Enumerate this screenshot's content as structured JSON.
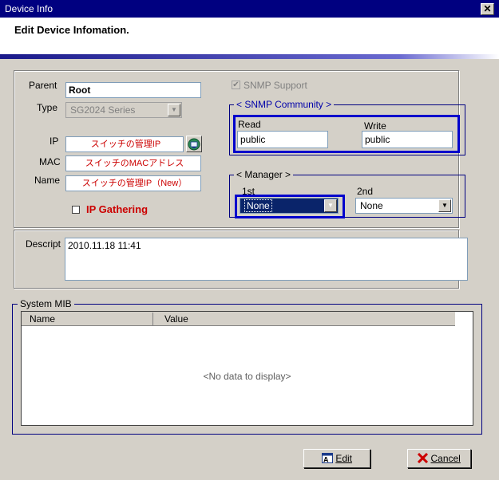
{
  "window": {
    "title": "Device Info",
    "close_glyph": "✕"
  },
  "header": {
    "title": "Edit Device Infomation."
  },
  "device": {
    "parent_label": "Parent",
    "parent_value": "Root",
    "type_label": "Type",
    "type_value": "SG2024 Series",
    "ip_label": "IP",
    "ip_value": "スイッチの管理IP",
    "mac_label": "MAC",
    "mac_value": "スイッチのMACアドレス",
    "name_label": "Name",
    "name_value": "スイッチの管理IP（New）",
    "ip_gathering_label": "IP Gathering"
  },
  "snmp": {
    "support_label": "SNMP Support",
    "community_legend": "< SNMP Community >",
    "read_label": "Read",
    "read_value": "public",
    "write_label": "Write",
    "write_value": "public"
  },
  "manager": {
    "legend": "< Manager >",
    "first_label": "1st",
    "first_value": "None",
    "second_label": "2nd",
    "second_value": "None"
  },
  "descript": {
    "label": "Descript",
    "value": "2010.11.18 11:41"
  },
  "system_mib": {
    "legend": "System MIB",
    "columns": [
      "Name",
      "Value"
    ],
    "empty_text": "<No data to display>"
  },
  "buttons": {
    "edit_label": "Edit",
    "cancel_label": "Cancel"
  },
  "colors": {
    "title_bar": "#000080",
    "highlight_frame": "#0000cc",
    "red_text": "#cc0000"
  }
}
